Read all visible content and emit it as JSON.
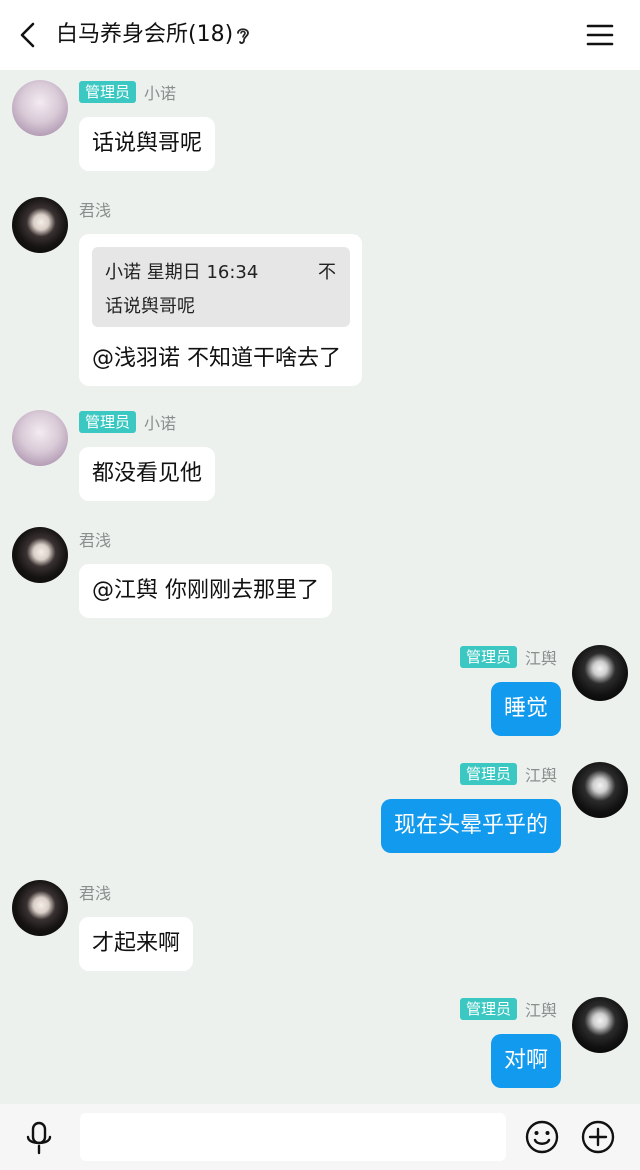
{
  "header": {
    "title": "白马养身会所(18)",
    "back_icon": "back-arrow-icon",
    "earpiece_icon": "ear-icon",
    "menu_icon": "hamburger-menu-icon"
  },
  "chat": {
    "admin_badge": "管理员",
    "messages": [
      {
        "sender": "小诺",
        "admin": true,
        "side": "left",
        "text": "话说舆哥呢"
      },
      {
        "sender": "君浅",
        "admin": false,
        "side": "left",
        "text": "@浅羽诺 不知道干啥去了",
        "quote": {
          "header": "小诺 星期日 16:34",
          "close": "不",
          "text": "话说舆哥呢"
        }
      },
      {
        "sender": "小诺",
        "admin": true,
        "side": "left",
        "text": "都没看见他"
      },
      {
        "sender": "君浅",
        "admin": false,
        "side": "left",
        "text": "@江舆 你刚刚去那里了"
      },
      {
        "sender": "江舆",
        "admin": true,
        "side": "right",
        "text": "睡觉"
      },
      {
        "sender": "江舆",
        "admin": true,
        "side": "right",
        "text": "现在头晕乎乎的"
      },
      {
        "sender": "君浅",
        "admin": false,
        "side": "left",
        "text": "才起来啊"
      },
      {
        "sender": "江舆",
        "admin": true,
        "side": "right",
        "text": "对啊"
      }
    ]
  },
  "composer": {
    "value": "",
    "mic_icon": "microphone-icon",
    "emoji_icon": "emoji-icon",
    "plus_icon": "plus-circle-icon"
  },
  "colors": {
    "background": "#edf1ee",
    "outgoing_bubble": "#129aee",
    "admin_badge": "#3bc8c2"
  }
}
